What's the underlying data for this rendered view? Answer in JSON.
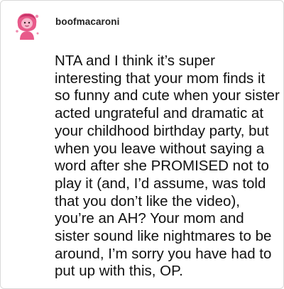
{
  "post": {
    "username": "boofmacaroni",
    "avatar_icon": "pink-cartoon-avatar-icon",
    "body": "NTA and I think it’s super interesting that your mom finds it so funny and cute when your sister acted ungrateful and dramatic at your childhood birthday party, but when you leave without saying a word after she PROMISED not to play it (and, I’d assume, was told that you don’t like the video), you’re an AH? Your mom and sister sound like nightmares to be around, I’m sorry you have had to put up with this, OP."
  },
  "colors": {
    "avatar_pink": "#e85a8a",
    "text": "#111111",
    "border": "#d9d9d9"
  }
}
